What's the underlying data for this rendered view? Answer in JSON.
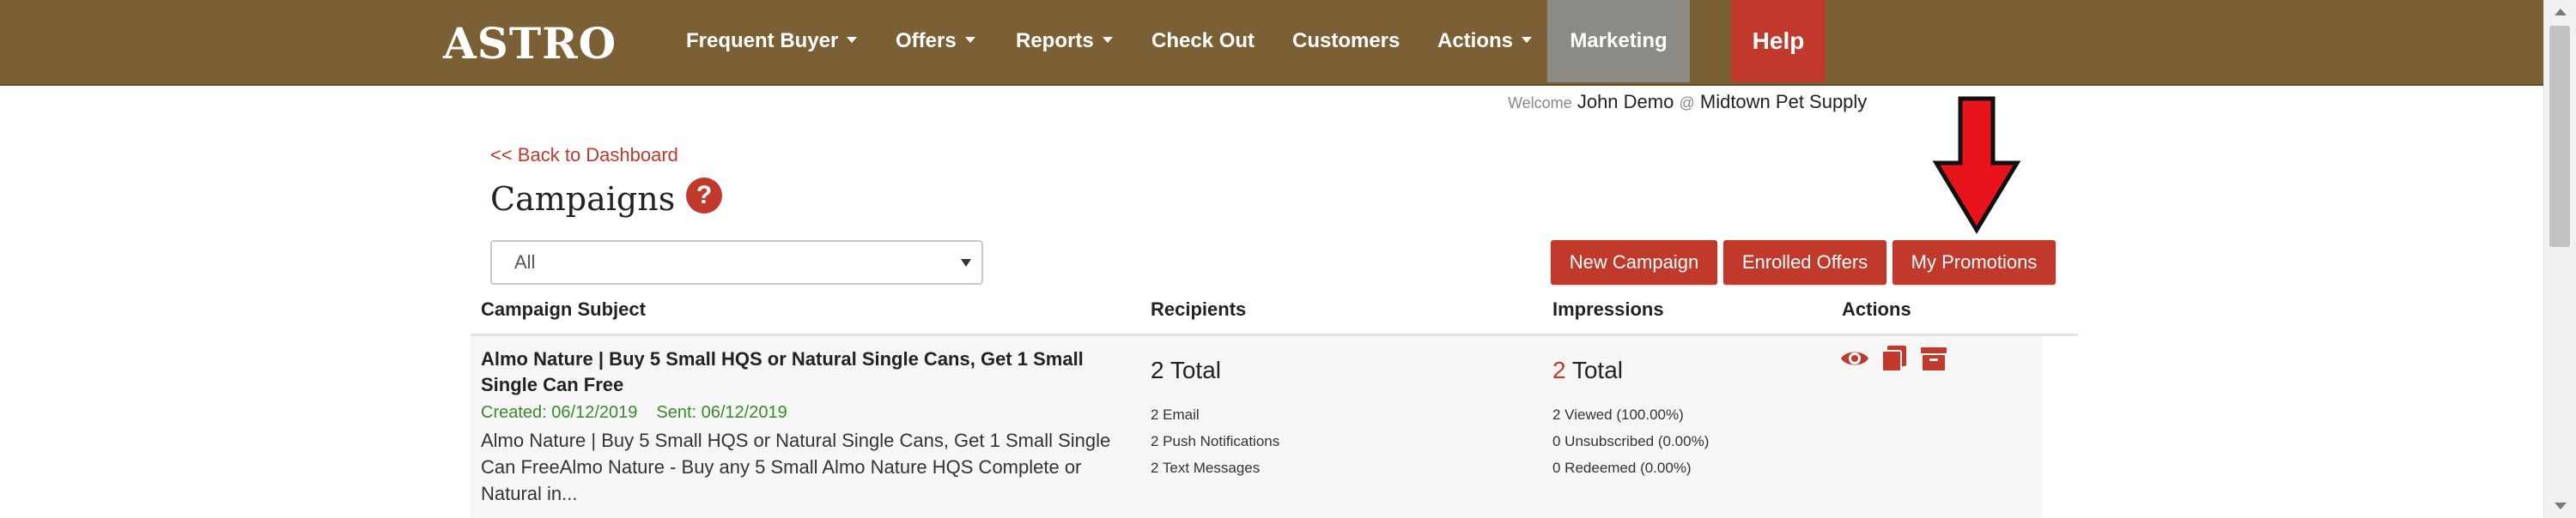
{
  "brand": {
    "logo_text": "ASTRO"
  },
  "nav": {
    "items": [
      {
        "label": "Frequent Buyer",
        "dropdown": true
      },
      {
        "label": "Offers",
        "dropdown": true
      },
      {
        "label": "Reports",
        "dropdown": true
      },
      {
        "label": "Check Out",
        "dropdown": false
      },
      {
        "label": "Customers",
        "dropdown": false
      },
      {
        "label": "Actions",
        "dropdown": true
      },
      {
        "label": "Marketing",
        "dropdown": false,
        "active": true
      }
    ],
    "help_label": "Help"
  },
  "welcome": {
    "prefix": "Welcome",
    "user": "John Demo",
    "at": "@",
    "store": "Midtown Pet Supply"
  },
  "back_link": "<< Back to Dashboard",
  "page": {
    "title": "Campaigns",
    "help_icon_glyph": "?"
  },
  "filter": {
    "selected": "All"
  },
  "buttons": {
    "new_campaign": "New Campaign",
    "enrolled_offers": "Enrolled Offers",
    "my_promotions": "My Promotions"
  },
  "table": {
    "headers": [
      "Campaign Subject",
      "Recipients",
      "Impressions",
      "Actions"
    ],
    "rows": [
      {
        "subject": "Almo Nature | Buy 5 Small HQS or Natural Single Cans, Get 1 Small Single Can Free",
        "created": "Created: 06/12/2019",
        "sent": "Sent: 06/12/2019",
        "description": "Almo Nature | Buy 5 Small HQS or Natural Single Cans, Get 1 Small Single Can FreeAlmo Nature - Buy any 5 Small Almo Nature HQS Complete or Natural in...",
        "recipients_total_num": "2",
        "recipients_total_label": "Total",
        "recipients_breakdown": [
          "2 Email",
          "2 Push Notifications",
          "2 Text Messages"
        ],
        "impressions_total_num": "2",
        "impressions_total_label": "Total",
        "impressions_breakdown": [
          "2 Viewed (100.00%)",
          "0 Unsubscribed (0.00%)",
          "0 Redeemed (0.00%)"
        ],
        "actions": [
          "eye-icon",
          "copy-icon",
          "archive-icon"
        ]
      }
    ]
  },
  "colors": {
    "nav_bg": "#7b6035",
    "accent": "#c0392b",
    "marketing_tab": "#8c8a85",
    "meta_green": "#3a8a2c"
  },
  "annotation": {
    "arrow_color": "#e8141c",
    "arrow_target": "My Promotions"
  }
}
